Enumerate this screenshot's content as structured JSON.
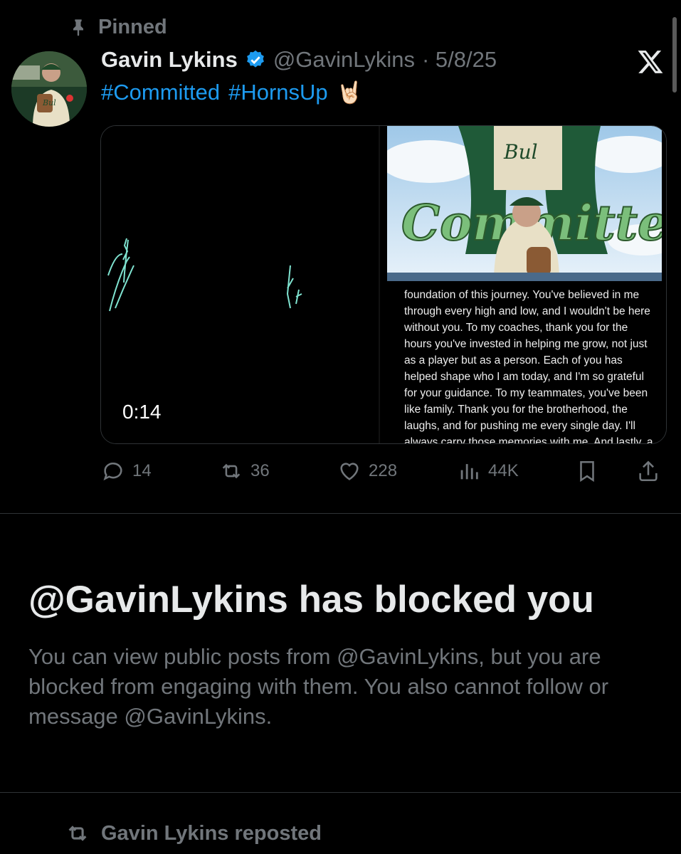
{
  "pinned_label": "Pinned",
  "post": {
    "author_name": "Gavin Lykins",
    "author_handle": "@GavinLykins",
    "date": "· 5/8/25",
    "hashtags": [
      "#Committed",
      "#HornsUp"
    ],
    "emoji": "🤘🏻",
    "video_duration": "0:14",
    "photo_text": "foundation of this journey. You've believed in me through every high and low, and I wouldn't be here without you. To my coaches, thank you for the hours you've invested in helping me grow, not just as a player but as a person. Each of you has helped shape who I am today, and I'm so grateful for your guidance. To my teammates, you've been like family. Thank you for the brotherhood, the laughs, and for pushing me every single day. I'll always carry those memories with me. And lastly, a",
    "photo_banner": "Committed",
    "stats": {
      "replies": "14",
      "reposts": "36",
      "likes": "228",
      "views": "44K"
    }
  },
  "blocked": {
    "title": "@GavinLykins has blocked you",
    "description": "You can view public posts from @GavinLykins, but you are blocked from engaging with them. You also cannot follow or message @GavinLykins."
  },
  "reposted_label": "Gavin Lykins reposted",
  "colors": {
    "accent": "#1d9bf0",
    "muted": "#71767b",
    "background": "#000000",
    "text": "#e7e9ea"
  },
  "icons": [
    "pin-icon",
    "verified-badge-icon",
    "x-logo-icon",
    "reply-icon",
    "repost-icon",
    "like-icon",
    "views-icon",
    "bookmark-icon",
    "share-icon"
  ]
}
